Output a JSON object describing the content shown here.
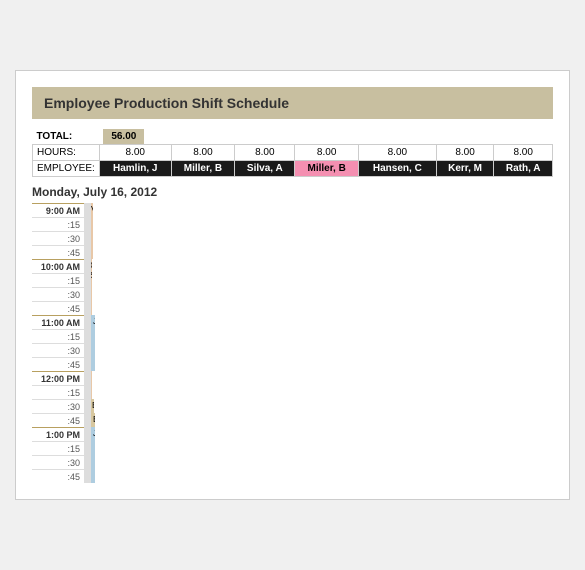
{
  "title": "Employee Production Shift Schedule",
  "summary": {
    "total_label": "TOTAL:",
    "total_value": "56.00",
    "hours_label": "HOURS:",
    "employee_label": "EMPLOYEE:"
  },
  "employees": [
    {
      "name": "Hamlin, J",
      "hours": "8.00",
      "highlight": false
    },
    {
      "name": "Miller, B",
      "hours": "8.00",
      "highlight": false
    },
    {
      "name": "Silva, A",
      "hours": "8.00",
      "highlight": false
    },
    {
      "name": "Miller, B",
      "hours": "8.00",
      "highlight": true
    },
    {
      "name": "Hansen, C",
      "hours": "8.00",
      "highlight": false
    },
    {
      "name": "Kerr, M",
      "hours": "8.00",
      "highlight": false
    },
    {
      "name": "Rath, A",
      "hours": "8.00",
      "highlight": false
    }
  ],
  "date_label": "Monday, July 16, 2012",
  "time_slots": [
    "9:00 AM",
    ":30",
    ":45",
    "10:00 AM",
    ":15",
    ":30",
    ":45",
    "11:00 AM",
    ":15",
    ":30",
    ":45",
    "12:00 PM",
    ":15",
    ":30",
    ":45",
    "1:00 PM",
    ":15",
    ":30",
    ":45"
  ]
}
